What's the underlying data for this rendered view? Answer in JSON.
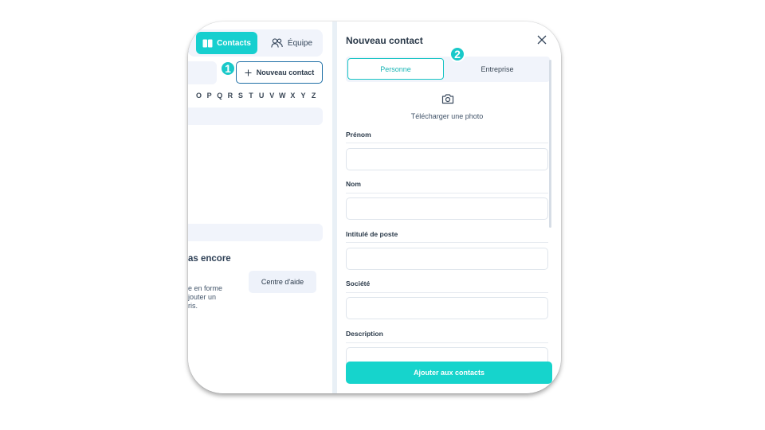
{
  "left_panel": {
    "tabs": {
      "contacts": "Contacts",
      "equipe": "Équipe"
    },
    "new_contact_button": "Nouveau contact",
    "step1_badge": "1",
    "alphabet": [
      "O",
      "P",
      "Q",
      "R",
      "S",
      "T",
      "U",
      "V",
      "W",
      "X",
      "Y",
      "Z"
    ],
    "empty_title": "as encore",
    "empty_text": "e en forme\njouter un\nris.",
    "help_button": "Centre d'aide"
  },
  "modal": {
    "title": "Nouveau contact",
    "segments": {
      "personne": "Personne",
      "entreprise": "Entreprise"
    },
    "step2_badge": "2",
    "upload_photo": "Télécharger une photo",
    "fields": {
      "prenom": "Prénom",
      "nom": "Nom",
      "intitule": "Intitulé de poste",
      "societe": "Société",
      "description": "Description"
    },
    "submit": "Ajouter aux contacts"
  },
  "colors": {
    "accent": "#16cfcf",
    "primary_border": "#1f6fa6",
    "submit": "#16d4cc"
  }
}
